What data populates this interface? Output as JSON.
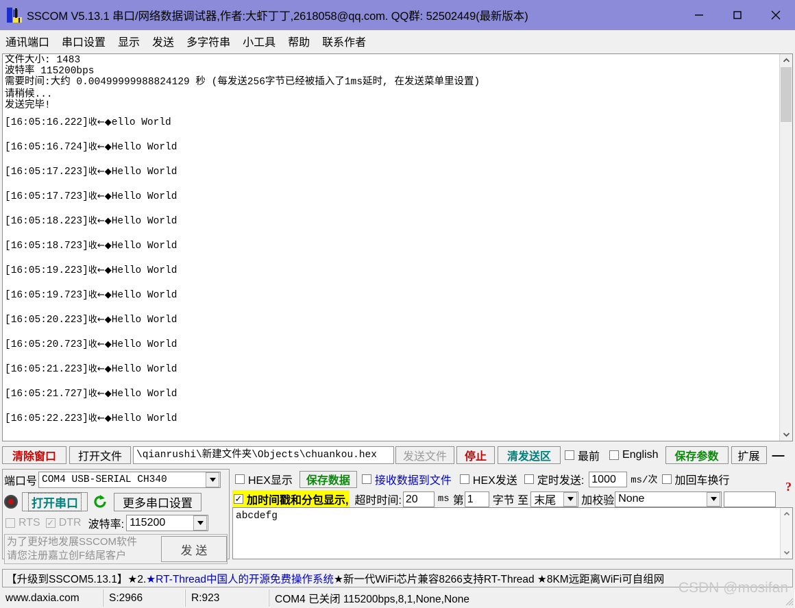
{
  "window": {
    "title": "SSCOM V5.13.1 串口/网络数据调试器,作者:大虾丁丁,2618058@qq.com. QQ群: 52502449(最新版本)",
    "icon": "sscom-app-icon",
    "minimize_label": "−",
    "maximize_label": "□",
    "close_label": "✕",
    "titlebar_color": "#8b8bd9"
  },
  "menu": {
    "items": [
      {
        "label": "通讯端口"
      },
      {
        "label": "串口设置"
      },
      {
        "label": "显示"
      },
      {
        "label": "发送"
      },
      {
        "label": "多字符串"
      },
      {
        "label": "小工具"
      },
      {
        "label": "帮助"
      },
      {
        "label": "联系作者"
      }
    ]
  },
  "receive": {
    "header_lines": [
      "文件大小: 1483",
      "波特率 115200bps",
      "需要时间:大约 0.00499999988824129 秒 (每发送256字节已经被插入了1ms延时, 在发送菜单里设置)",
      "请稍候...",
      "发送完毕!"
    ],
    "log_lines": [
      {
        "ts": "[16:05:16.222]",
        "dir": "收←◆",
        "text": "ello World"
      },
      {
        "ts": "[16:05:16.724]",
        "dir": "收←◆",
        "text": "Hello World"
      },
      {
        "ts": "[16:05:17.223]",
        "dir": "收←◆",
        "text": "Hello World"
      },
      {
        "ts": "[16:05:17.723]",
        "dir": "收←◆",
        "text": "Hello World"
      },
      {
        "ts": "[16:05:18.223]",
        "dir": "收←◆",
        "text": "Hello World"
      },
      {
        "ts": "[16:05:18.723]",
        "dir": "收←◆",
        "text": "Hello World"
      },
      {
        "ts": "[16:05:19.223]",
        "dir": "收←◆",
        "text": "Hello World"
      },
      {
        "ts": "[16:05:19.723]",
        "dir": "收←◆",
        "text": "Hello World"
      },
      {
        "ts": "[16:05:20.223]",
        "dir": "收←◆",
        "text": "Hello World"
      },
      {
        "ts": "[16:05:20.723]",
        "dir": "收←◆",
        "text": "Hello World"
      },
      {
        "ts": "[16:05:21.223]",
        "dir": "收←◆",
        "text": "Hello World"
      },
      {
        "ts": "[16:05:21.727]",
        "dir": "收←◆",
        "text": "Hello World"
      },
      {
        "ts": "[16:05:22.223]",
        "dir": "收←◆",
        "text": "Hello World"
      }
    ],
    "scrollbar_up_icon": "chevron-up-icon",
    "scrollbar_down_icon": "chevron-down-icon"
  },
  "toolbar": {
    "clear_window": "清除窗口",
    "open_file": "打开文件",
    "file_path": "\\qianrushi\\新建文件夹\\Objects\\chuankou.hex",
    "send_file": "发送文件",
    "stop": "停止",
    "clear_send": "清发送区",
    "topmost_label": "最前",
    "topmost_checked": false,
    "english_label": "English",
    "english_checked": false,
    "save_params": "保存参数",
    "extend": "扩展",
    "collapse": "—",
    "colors": {
      "clear_window": "#d00000",
      "stop": "#d00000",
      "clear_send": "#00807a",
      "save_params": "#0a8a0a",
      "send_file_disabled": "#9a9a9a"
    }
  },
  "port_panel": {
    "port_label": "端口号",
    "port_value": "COM4 USB-SERIAL CH340",
    "open_port_button": "打开串口",
    "refresh_icon": "refresh-icon",
    "more_settings": "更多串口设置",
    "rts_label": "RTS",
    "rts_checked": false,
    "dtr_label": "DTR",
    "dtr_checked": true,
    "baud_label": "波特率:",
    "baud_value": "115200",
    "register_text_line1": "为了更好地发展SSCOM软件",
    "register_text_line2": "请您注册嘉立创F结尾客户",
    "send_button": "发 送"
  },
  "options": {
    "hex_display_label": "HEX显示",
    "hex_display_checked": false,
    "save_data": "保存数据",
    "recv_to_file_label": "接收数据到文件",
    "recv_to_file_checked": false,
    "hex_send_label": "HEX发送",
    "hex_send_checked": false,
    "timed_send_label": "定时发送:",
    "timed_send_checked": false,
    "timed_send_value": "1000",
    "timed_send_unit": "ms/次",
    "crlf_label": "加回车换行",
    "crlf_checked": false,
    "timestamp_label": "加时间戳和分包显示,",
    "timestamp_checked": true,
    "timeout_label": "超时时间:",
    "timeout_value": "20",
    "timeout_unit": "ms",
    "byte_prefix": "第",
    "byte_value": "1",
    "byte_mid": "字节 至",
    "byte_end": "末尾",
    "checksum_label": "加校验",
    "checksum_value": "None",
    "help_icon": "question-mark-icon"
  },
  "send_area": {
    "value": "abcdefg",
    "scroll_up_icon": "chevron-up-icon",
    "scroll_down_icon": "chevron-down-icon"
  },
  "banner": {
    "part1": "【升级到SSCOM5.13.1】★2.  ",
    "part2": "★RT-Thread中国人的开源免费操作系统",
    "part3": " ★新一代WiFi芯片兼容8266支持RT-Thread ★8KM远距离WiFi可自组网"
  },
  "statusbar": {
    "site": "www.daxia.com",
    "sent": "S:2966",
    "received": "R:923",
    "port_status": "COM4 已关闭  115200bps,8,1,None,None"
  },
  "watermark": "CSDN @mosifan"
}
